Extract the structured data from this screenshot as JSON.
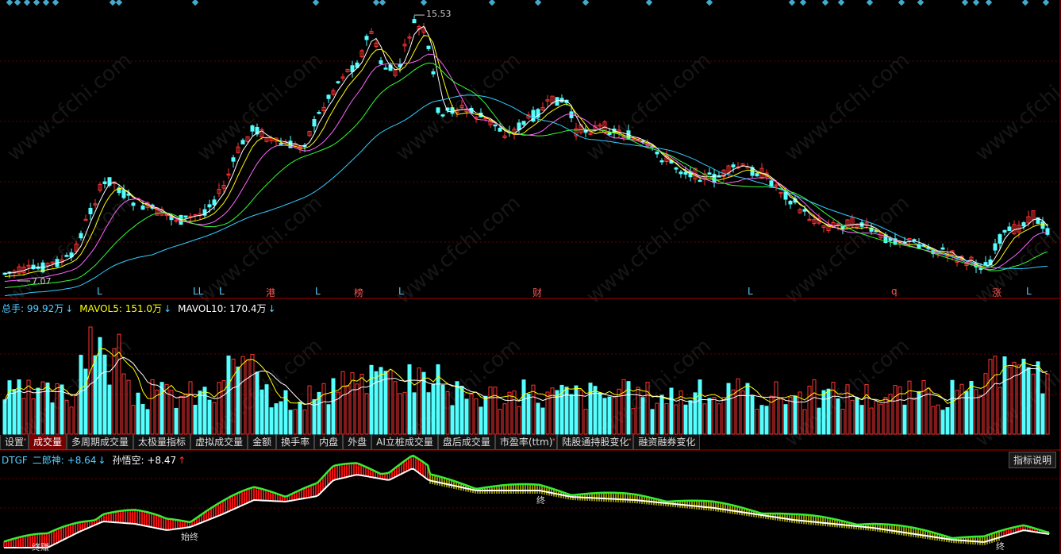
{
  "price_panel": {
    "high_label": "15.53",
    "low_label": "7.07",
    "signals": [
      {
        "text": "L",
        "color": "#5cf"
      },
      {
        "text": "LL",
        "color": "#5cf"
      },
      {
        "text": "L",
        "color": "#5cf"
      },
      {
        "text": "港",
        "color": "#f55"
      },
      {
        "text": "L",
        "color": "#5cf"
      },
      {
        "text": "榜",
        "color": "#f55"
      },
      {
        "text": "L",
        "color": "#5cf"
      },
      {
        "text": "财",
        "color": "#f55"
      },
      {
        "text": "L",
        "color": "#5cf"
      },
      {
        "text": "q",
        "color": "#f55"
      },
      {
        "text": "涨",
        "color": "#f55"
      },
      {
        "text": "L",
        "color": "#5cf"
      }
    ]
  },
  "volume_panel": {
    "legend": [
      {
        "text": "总手: 99.92万",
        "arrow": "↓",
        "color": "#5cf"
      },
      {
        "text": "MAVOL5: 151.0万",
        "arrow": "↓",
        "color": "#ff0"
      },
      {
        "text": "MAVOL10: 170.4万",
        "arrow": "↓",
        "color": "#fff"
      }
    ]
  },
  "tabs": [
    {
      "label": "设置",
      "dot": true
    },
    {
      "label": "成交量",
      "active": true
    },
    {
      "label": "多周期成交量"
    },
    {
      "label": "太极量指标"
    },
    {
      "label": "虚拟成交量"
    },
    {
      "label": "金额"
    },
    {
      "label": "换手率"
    },
    {
      "label": "内盘"
    },
    {
      "label": "外盘"
    },
    {
      "label": "AI立桩成交量"
    },
    {
      "label": "盘后成交量"
    },
    {
      "label": "市盈率(ttm)",
      "dot": true
    },
    {
      "label": "陆股通持股变化",
      "dot": true
    },
    {
      "label": "融资融券变化"
    }
  ],
  "indicator_panel": {
    "legend": [
      {
        "text": "DTGF",
        "color": "#5cf"
      },
      {
        "text": "二郎神: +8.64",
        "arrow": "↓",
        "color": "#5cf"
      },
      {
        "text": "孙悟空: +8.47",
        "arrow": "↑",
        "color": "#fff"
      }
    ],
    "help_label": "指标说明",
    "marks": [
      "终赚",
      "始终",
      "终",
      "终"
    ]
  },
  "watermark": "www.cfchi.com",
  "colors": {
    "up": "#f33",
    "down": "#5ff",
    "ma5": "#fff",
    "ma10": "#ff0",
    "ma20": "#f6f",
    "ma30": "#3f3",
    "ma60": "#3cf",
    "bg": "#000",
    "grid": "#600"
  }
}
